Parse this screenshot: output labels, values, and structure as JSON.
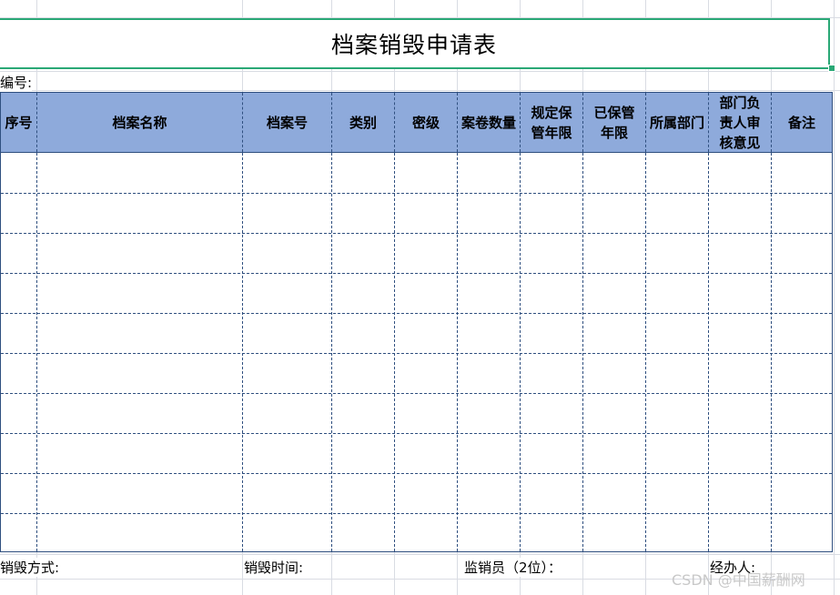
{
  "form": {
    "title": "档案销毁申请表",
    "number_label": "编号:",
    "headers": [
      "序号",
      "档案名称",
      "档案号",
      "类别",
      "密级",
      "案卷数量",
      "规定保管年限",
      "已保管年限",
      "所属部门",
      "部门负责人审核意见",
      "备注"
    ],
    "empty_rows": 10,
    "footer": {
      "method": "销毁方式:",
      "time": "销毁时间:",
      "supervisor": "监销员（2位）：",
      "handler": "经办人:"
    }
  },
  "watermark": "CSDN @中国薪酬网",
  "colors": {
    "header_fill": "#8eaadb",
    "border": "#2f4f7f",
    "selection": "#2aa876"
  }
}
